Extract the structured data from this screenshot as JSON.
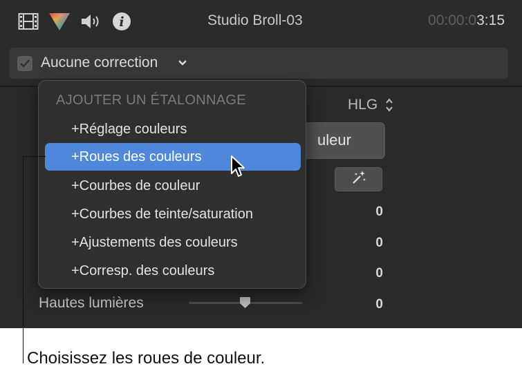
{
  "header": {
    "title": "Studio Broll-03",
    "timecode_dim": "00:00:0",
    "timecode_bright": "3:15",
    "icons": [
      "film-icon",
      "color-triangle-icon",
      "speaker-icon",
      "info-icon"
    ]
  },
  "correction": {
    "label": "Aucune correction",
    "checked": true
  },
  "inspector": {
    "hlg_label": "HLG",
    "button_partial_label": "uleur",
    "values": [
      "0",
      "0",
      "0",
      "0"
    ],
    "highlights_label": "Hautes lumières"
  },
  "menu": {
    "header": "AJOUTER UN ÉTALONNAGE",
    "items": [
      "+Réglage couleurs",
      "+Roues des couleurs",
      "+Courbes de couleur",
      "+Courbes de teinte/saturation",
      "+Ajustements des couleurs",
      "+Corresp. des couleurs"
    ],
    "selected_index": 1
  },
  "callout": {
    "text": "Choisissez les roues de couleur."
  },
  "colors": {
    "app_bg": "#2a2a2a",
    "menu_bg": "#303030",
    "selection": "#4f88da",
    "text": "#e3e3e3"
  }
}
